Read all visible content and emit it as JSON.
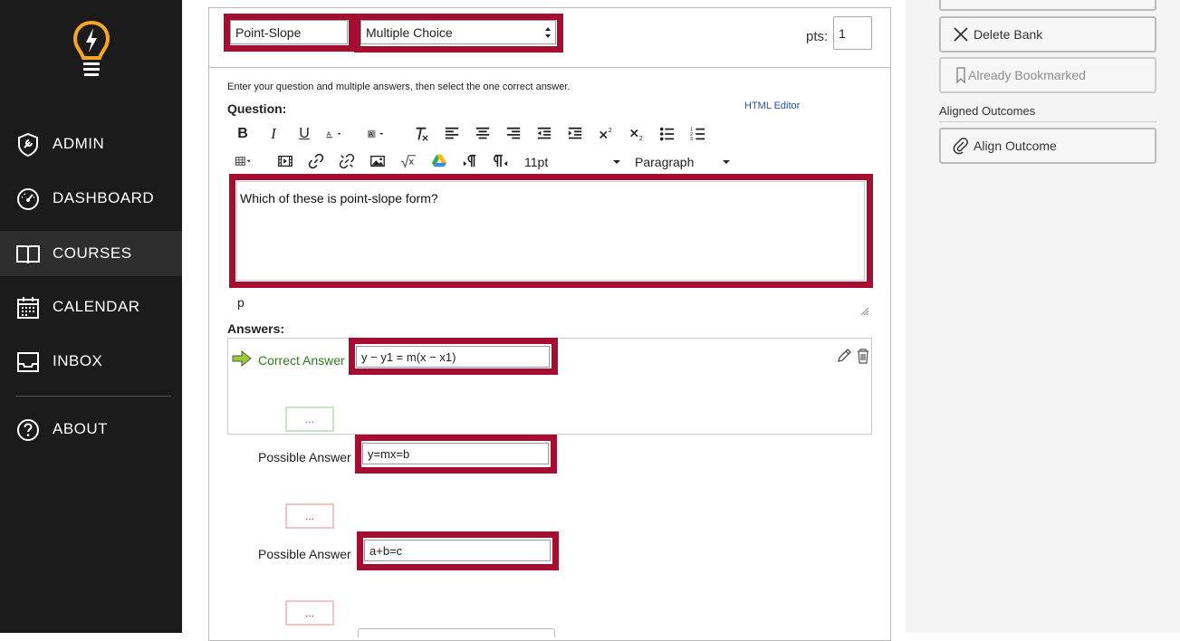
{
  "nav": {
    "items": [
      {
        "label": "ADMIN",
        "icon": "shield-wrench-icon"
      },
      {
        "label": "DASHBOARD",
        "icon": "gauge-icon"
      },
      {
        "label": "COURSES",
        "icon": "book-icon"
      },
      {
        "label": "CALENDAR",
        "icon": "calendar-icon"
      },
      {
        "label": "INBOX",
        "icon": "inbox-icon"
      },
      {
        "label": "ABOUT",
        "icon": "question-icon"
      }
    ],
    "active": "COURSES"
  },
  "question": {
    "name": "Point-Slope",
    "type": "Multiple Choice",
    "pts_label": "pts:",
    "pts_value": "1",
    "instructions": "Enter your question and multiple answers, then select the one correct answer.",
    "question_label": "Question:",
    "html_editor_link": "HTML Editor",
    "font_size": "11pt",
    "block_format": "Paragraph",
    "body": "Which of these is point-slope form?",
    "status_path": "p",
    "answers_label": "Answers:"
  },
  "answers": [
    {
      "label": "Correct Answer",
      "value": "y − y1 = m(x − x1)",
      "dots": "..."
    },
    {
      "label": "Possible Answer",
      "value": "y=mx=b",
      "dots": "..."
    },
    {
      "label": "Possible Answer",
      "value": "a+b=c",
      "dots": "..."
    }
  ],
  "right": {
    "delete_bank": "Delete Bank",
    "bookmarked": "Already Bookmarked",
    "aligned_outcomes": "Aligned Outcomes",
    "align_outcome": "Align Outcome"
  },
  "colors": {
    "sidebar": "#1b1b1b",
    "highlight": "#a50e31",
    "correct_green": "#2e7d1e",
    "logo": "#f5a623"
  }
}
